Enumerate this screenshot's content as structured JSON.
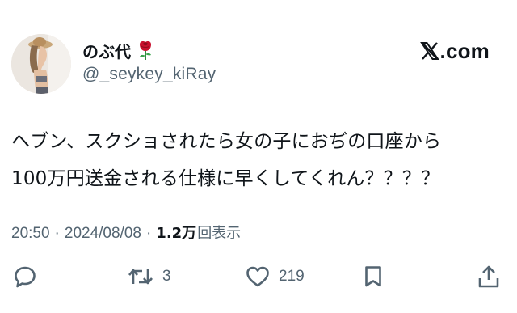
{
  "author": {
    "display_name": "のぶ代",
    "handle": "@_seykey_kiRay",
    "badge_icon": "rose-icon",
    "avatar_icon": "avatar-photo"
  },
  "brand": {
    "icon": "x-logo-icon",
    "domain_text": ".com"
  },
  "tweet": {
    "lines": [
      "ヘブン、スクショされたら女の子におぢの口座から",
      "100万円送金される仕様に早くしてくれん？？？？"
    ]
  },
  "meta": {
    "time": "20:50",
    "separator": "·",
    "date": "2024/08/08",
    "views_count": "1.2万",
    "views_label": "回表示"
  },
  "actions": {
    "reply": {
      "icon": "reply-icon",
      "count": ""
    },
    "retweet": {
      "icon": "retweet-icon",
      "count": "3"
    },
    "like": {
      "icon": "heart-icon",
      "count": "219"
    },
    "bookmark": {
      "icon": "bookmark-icon",
      "count": ""
    },
    "share": {
      "icon": "share-icon",
      "count": ""
    }
  },
  "colors": {
    "text_primary": "#0f1419",
    "text_secondary": "#536471",
    "background": "#ffffff",
    "rose": "#c8102e"
  }
}
